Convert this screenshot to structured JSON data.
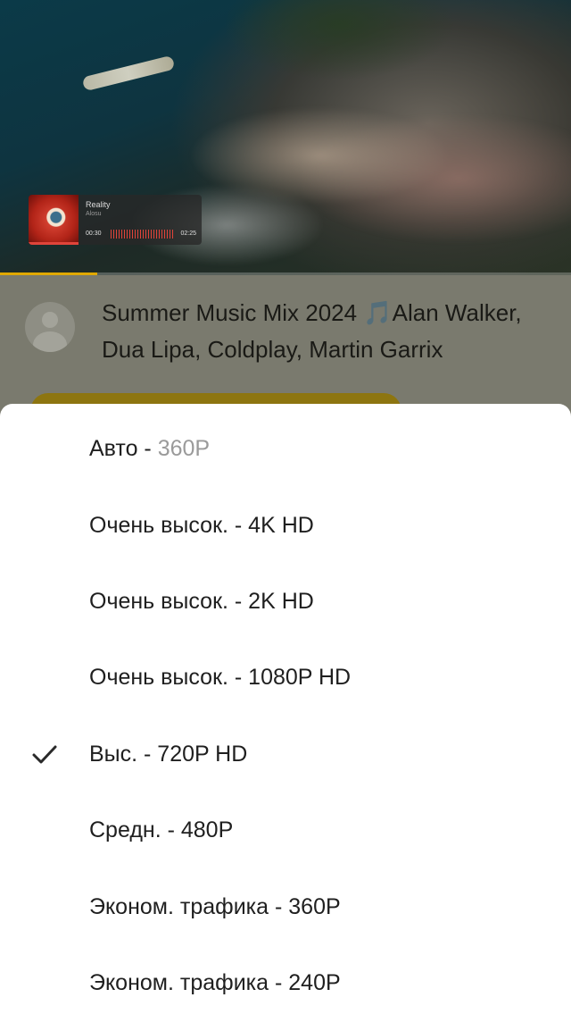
{
  "player": {
    "mini_track_title": "Reality",
    "mini_track_artist": "Alosu",
    "mini_time_current": "00:30",
    "mini_time_total": "02:25",
    "video_progress_fraction": 0.17
  },
  "video_info": {
    "title": "Summer Music Mix 2024 🎵Alan Walker, Dua Lipa, Coldplay, Martin Garrix"
  },
  "quality_menu": {
    "selected_index": 4,
    "items": [
      {
        "label": "Авто - ",
        "sub": "360P"
      },
      {
        "label": "Очень высок. - 4K HD",
        "sub": ""
      },
      {
        "label": "Очень высок. - 2K HD",
        "sub": ""
      },
      {
        "label": "Очень высок. - 1080P HD",
        "sub": ""
      },
      {
        "label": "Выс. - 720P HD",
        "sub": ""
      },
      {
        "label": "Средн. - 480P",
        "sub": ""
      },
      {
        "label": "Эконом. трафика - 360P",
        "sub": ""
      },
      {
        "label": "Эконом. трафика - 240P",
        "sub": ""
      }
    ]
  },
  "colors": {
    "accent": "#e0a800",
    "sheet_background": "#ffffff",
    "dim_overlay": "#7a7a6e",
    "text_primary": "#1f1f1f",
    "text_secondary": "#9a9a9a"
  },
  "icons": {
    "selected_marker": "check-icon",
    "channel_placeholder": "user-avatar-icon"
  }
}
